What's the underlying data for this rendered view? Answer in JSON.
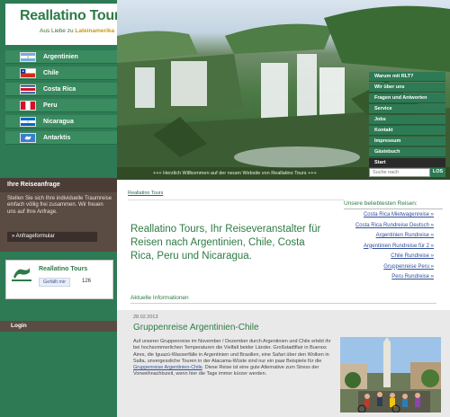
{
  "brand": {
    "name": "Reallatino Tours",
    "tagline_prefix": "Aus Liebe zu ",
    "tagline_bold": "Lateinamerika"
  },
  "countries": [
    {
      "label": "Argentinien",
      "flag": "argentina"
    },
    {
      "label": "Chile",
      "flag": "chile"
    },
    {
      "label": "Costa Rica",
      "flag": "costa-rica"
    },
    {
      "label": "Peru",
      "flag": "peru"
    },
    {
      "label": "Nicaragua",
      "flag": "nicaragua"
    },
    {
      "label": "Antarktis",
      "flag": "antarctica"
    }
  ],
  "reiseanfrage": {
    "heading": "Ihre Reiseanfrage",
    "text": "Stellen Sie sich Ihre individuelle Traumreise einfach völlig frei zusammen. Wir freuen uns auf Ihre Anfrage.",
    "button": "» Anfrageformular"
  },
  "facebook": {
    "name": "Reallatino Tours",
    "like_label": "Gefällt mir",
    "count": "126"
  },
  "login": {
    "label": "Login"
  },
  "hero": {
    "ticker": "+++ Herzlich Willkommen auf der neuen Website von Reallatino Tours +++"
  },
  "right_nav": [
    {
      "label": "Warum mit RLT?",
      "selected": false
    },
    {
      "label": "Wir über uns",
      "selected": false
    },
    {
      "label": "Fragen und Antworten",
      "selected": false
    },
    {
      "label": "Service",
      "selected": false
    },
    {
      "label": "Jobs",
      "selected": false
    },
    {
      "label": "Kontakt",
      "selected": false
    },
    {
      "label": "Impressum",
      "selected": false
    },
    {
      "label": "Gästebuch",
      "selected": false
    },
    {
      "label": "Start",
      "selected": true
    }
  ],
  "search": {
    "placeholder": "Suche nach",
    "button": "LOS"
  },
  "breadcrumb": "Reallatino Tours",
  "headline": "Reallatino Tours, Ihr Reiseveranstalter für Reisen nach Argentinien, Chile, Costa Rica, Peru und Nicaragua.",
  "popular": {
    "title": "Unsere beliebtesten Reisen:",
    "links": [
      "Costa Rica Mietwagenreise »",
      "Costa Rica Rundreise Deutsch »",
      "Argentinien Rundreise »",
      "Argentinien Rundreise für 2 »",
      "Chile Rundreise »",
      "Gruppenreise Peru »",
      "Peru Rundreise »"
    ]
  },
  "news": {
    "heading": "Aktuelle Informationen",
    "date": "28.02.2013",
    "title": "Gruppenreise Argentinien-Chile",
    "body_before": "Auf unserer Gruppenreise im November / Dezember durch Argentinien und Chile erlebt ihr bei hochsommerlichen Temperaturen die Vielfalt beider Länder. Großstadtflair in Buenos Aires, die Iguazú-Wasserfälle in Argentinien und Brasilien, eine Safari über den Wolken in Salta, unvergessliche Touren in der Atacama-Wüste sind nur ein paar Beispiele für die ",
    "body_link": "Gruppenreise Argentinien-Chile",
    "body_after": ". Diese Reise ist eine gute Alternative zum Stress der Vorweihnachtszeit, wenn hier die Tage immer kürzer werden."
  },
  "colors": {
    "green": "#2e7a55",
    "brown": "#5a4b43",
    "link": "#2f4f9b",
    "headline": "#2e7a44"
  }
}
